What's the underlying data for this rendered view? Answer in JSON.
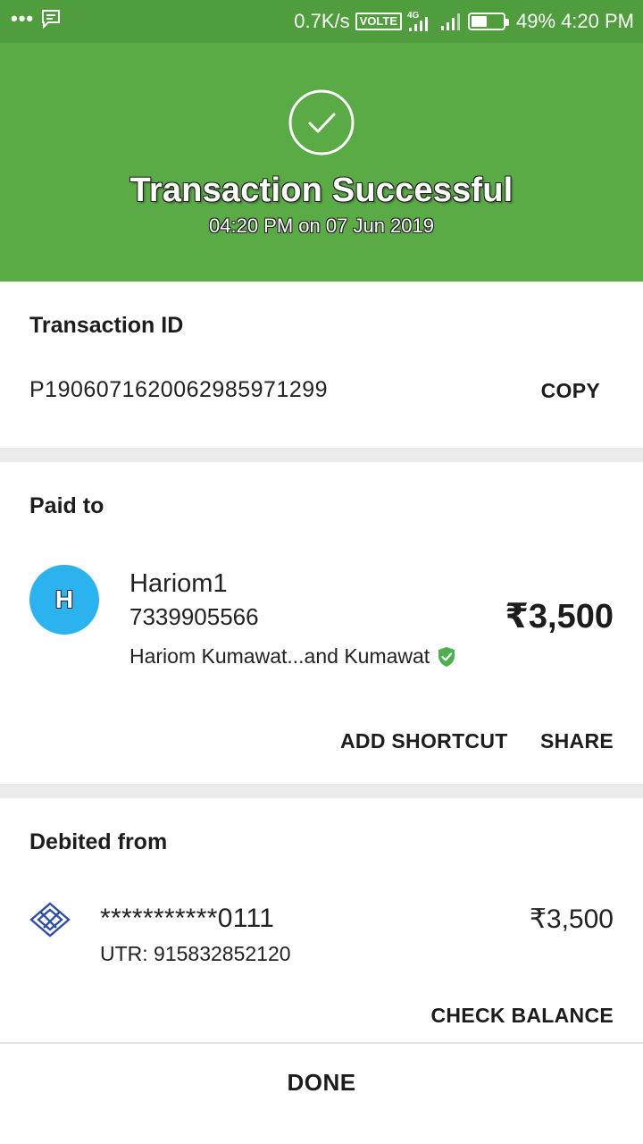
{
  "status_bar": {
    "speed": "0.7K/s",
    "volte": "VOLTE",
    "network": "4G",
    "battery": "49%",
    "battery_level": 0.49,
    "time": "4:20 PM"
  },
  "header": {
    "title": "Transaction Successful",
    "subtitle": "04:20 PM on 07 Jun 2019",
    "accent_color": "#5aaa46"
  },
  "transaction": {
    "label": "Transaction ID",
    "id": "P1906071620062985971299",
    "copy_label": "COPY"
  },
  "paid_to": {
    "label": "Paid to",
    "avatar_letter": "H",
    "name": "Hariom1",
    "phone": "7339905566",
    "account_name": "Hariom Kumawat...and Kumawat",
    "amount": "₹3,500",
    "add_shortcut_label": "ADD SHORTCUT",
    "share_label": "SHARE"
  },
  "debited_from": {
    "label": "Debited from",
    "account": "***********0111",
    "utr": "UTR: 915832852120",
    "amount": "₹3,500",
    "check_balance_label": "CHECK BALANCE"
  },
  "footer": {
    "done_label": "DONE"
  }
}
